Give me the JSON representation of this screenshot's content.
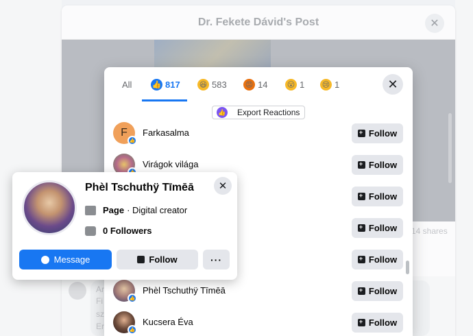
{
  "post": {
    "title": "Dr. Fekete Dávid's Post",
    "shares": "14 shares",
    "comment_author": "Ar",
    "comment_lines": [
      "Fi",
      "sz",
      "Er"
    ]
  },
  "reactions": {
    "tabs": [
      {
        "label": "All",
        "count": ""
      },
      {
        "label": "",
        "count": "817",
        "icon": "like-icon",
        "color": "#1877f2"
      },
      {
        "label": "",
        "count": "583",
        "icon": "haha-icon",
        "color": "#f7b928"
      },
      {
        "label": "",
        "count": "14",
        "icon": "angry-icon",
        "color": "#e9710f"
      },
      {
        "label": "",
        "count": "1",
        "icon": "wow-icon",
        "color": "#f7b928"
      },
      {
        "label": "",
        "count": "1",
        "icon": "sad-icon",
        "color": "#f7b928"
      }
    ],
    "export_label": "Export Reactions",
    "follow_label": "Follow",
    "people": [
      {
        "name": "Farkasalma",
        "initial": "F",
        "color": "#f0a05a"
      },
      {
        "name": "Virágok világa",
        "initial": "",
        "color": "#c58a6a"
      },
      {
        "name": "",
        "initial": "",
        "color": "#d2d4d8"
      },
      {
        "name": "",
        "initial": "",
        "color": "#d2d4d8"
      },
      {
        "name": "",
        "initial": "",
        "color": "#d2d4d8"
      },
      {
        "name": "Phèl Tschuthÿ Tīmēā",
        "initial": "",
        "color": "#a37b78"
      },
      {
        "name": "Kucsera Éva",
        "initial": "",
        "color": "#6b4a3a"
      }
    ]
  },
  "card": {
    "name": "Phèl Tschuthÿ Tīmēā",
    "type_bold": "Page",
    "type_rest": "· Digital creator",
    "followers_bold": "0 Followers",
    "message_label": "Message",
    "follow_label": "Follow",
    "more_label": "···"
  }
}
